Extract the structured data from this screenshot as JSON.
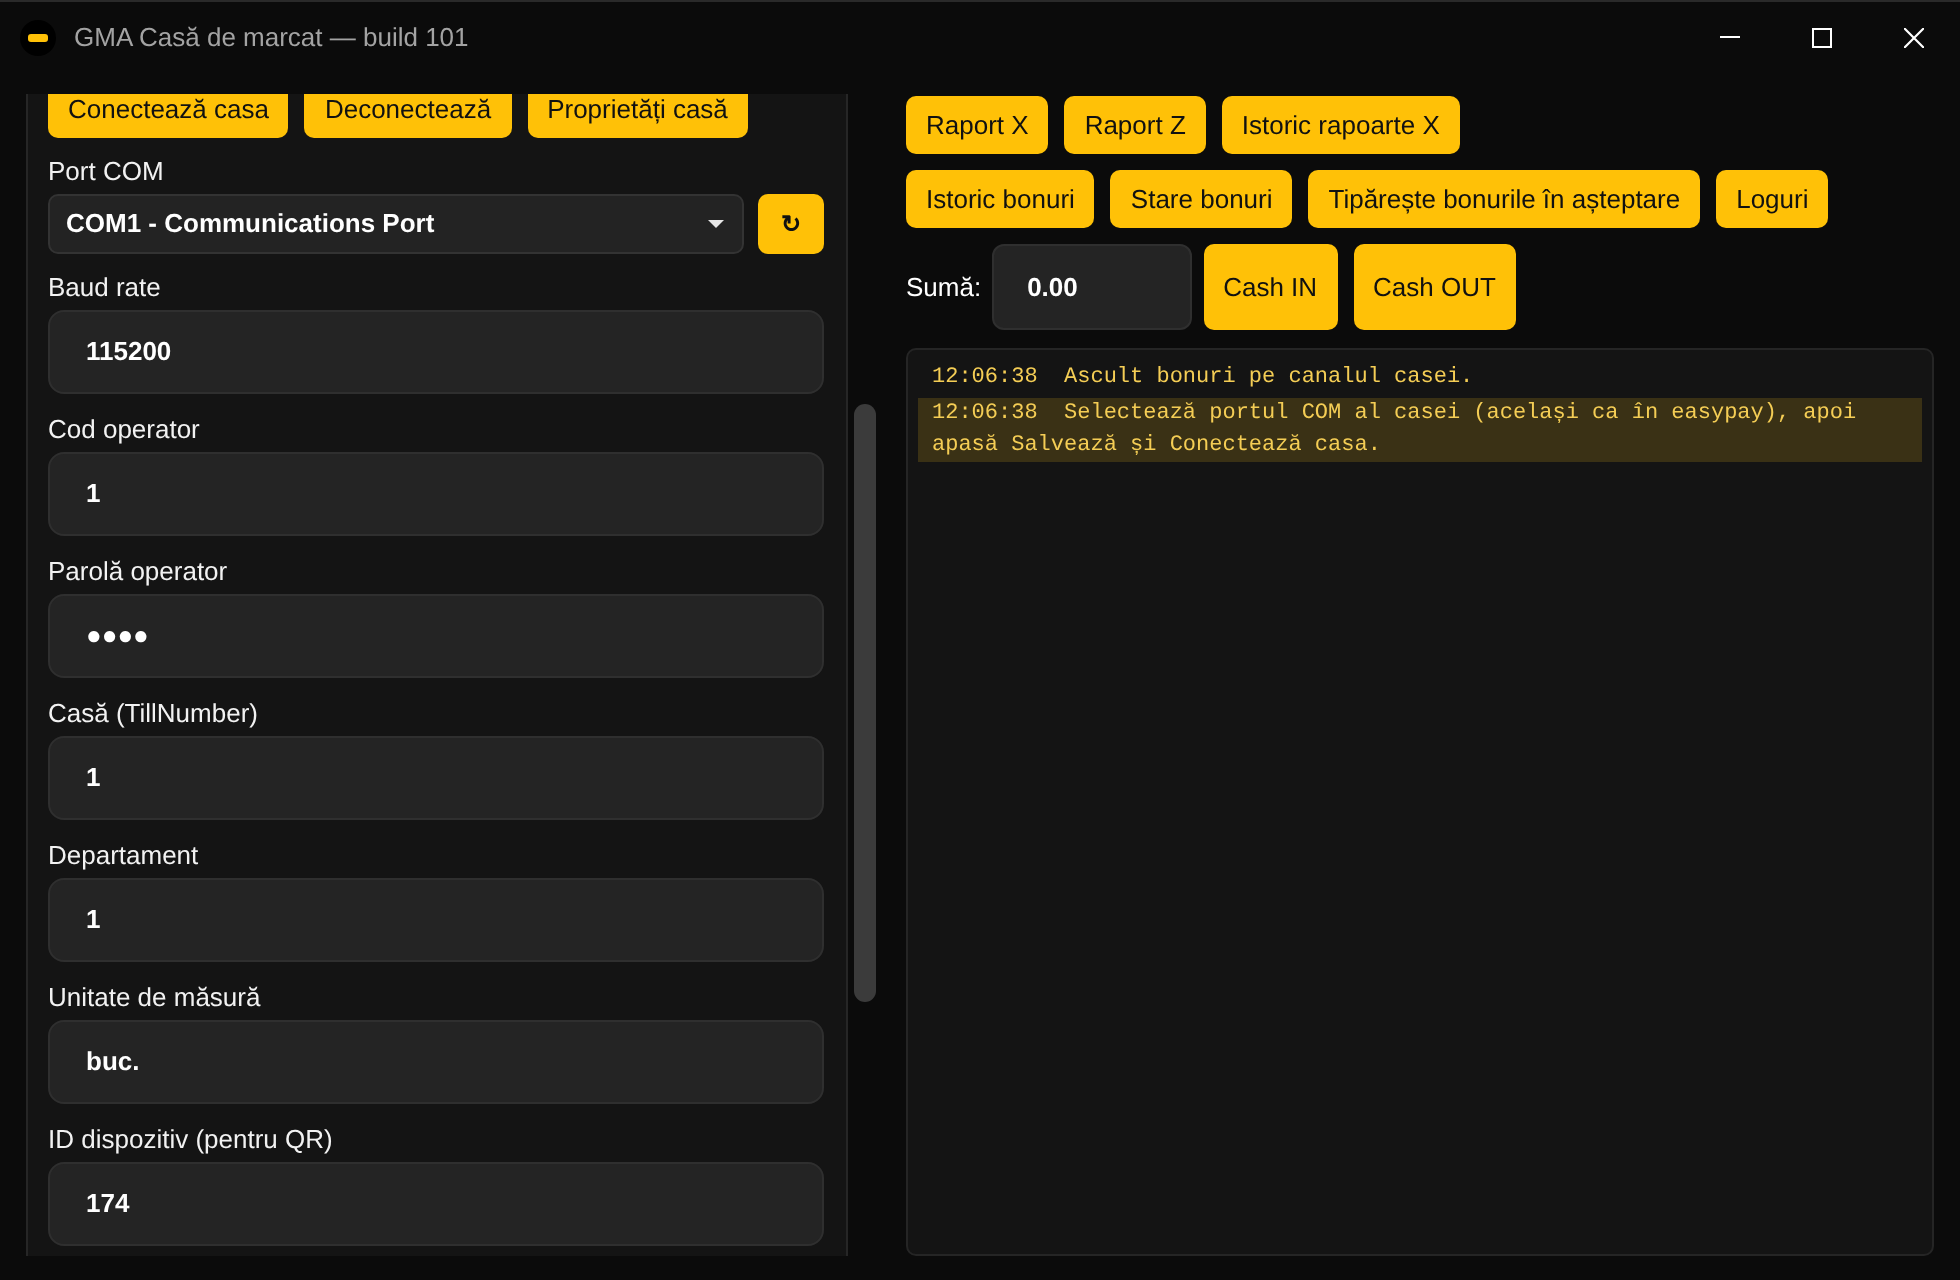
{
  "window": {
    "title": "GMA Casă de marcat — build 101"
  },
  "connection_buttons": [
    "Conectează casa",
    "Deconectează",
    "Proprietăți casă"
  ],
  "port": {
    "label": "Port COM",
    "value": "COM1 - Communications Port",
    "refresh_button": "↻"
  },
  "fields": [
    {
      "label": "Baud rate",
      "value": "115200"
    },
    {
      "label": "Cod operator",
      "value": "1"
    },
    {
      "label": "Parolă operator",
      "value": "●●●●"
    },
    {
      "label": "Casă (TillNumber)",
      "value": "1"
    },
    {
      "label": "Departament",
      "value": "1"
    },
    {
      "label": "Unitate de măsură",
      "value": "buc."
    },
    {
      "label": "ID dispozitiv (pentru QR)",
      "value": "174"
    }
  ],
  "report_buttons": [
    [
      "Raport X",
      "Raport Z",
      "Istoric rapoarte X"
    ],
    [
      "Istoric bonuri",
      "Stare bonuri",
      "Tipărește bonurile în așteptare",
      "Loguri"
    ]
  ],
  "cash": {
    "label": "Sumă:",
    "value": "0.00",
    "buttons": [
      "Cash IN",
      "Cash OUT"
    ]
  },
  "log": {
    "entries": [
      {
        "text": "12:06:38  Ascult bonuri pe canalul casei.",
        "kind": "info"
      },
      {
        "text": "12:06:38  Selectează portul COM al casei (același ca în easypay), apoi apasă Salvează și Conectează casa.",
        "kind": "warning"
      }
    ]
  }
}
